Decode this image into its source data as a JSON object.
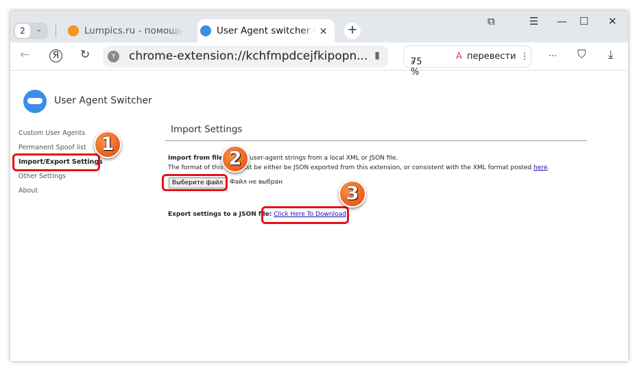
{
  "browser": {
    "tab_count": "2",
    "tabs": [
      {
        "title": "Lumpics.ru - помощь с компьютером",
        "icon": "orange-icon"
      },
      {
        "title": "User Agent switcher controls",
        "icon": "mask-icon",
        "close": "×"
      }
    ],
    "new_tab": "+",
    "url": "chrome-extension://kchfmpdcejfkipopn...",
    "zoom": "75 %",
    "translate": "перевести",
    "more": "..."
  },
  "app": {
    "title": "User Agent Switcher"
  },
  "sidebar": {
    "items": [
      {
        "label": "Custom User Agents"
      },
      {
        "label": "Permanent Spoof list"
      },
      {
        "label": "Import/Export Settings",
        "active": true
      },
      {
        "label": "Other Settings"
      },
      {
        "label": "About"
      }
    ]
  },
  "main": {
    "heading": "Import Settings",
    "import_label": "Import from file:",
    "import_text": " Import user-agent strings from a local XML or JSON file.",
    "format_text": "The format of this file must be either be JSON exported from this extension, or consistent with the XML format posted ",
    "here_link": "here",
    "choose_button": "Выберите файл",
    "no_file": "Файл не выбран",
    "export_label": "Export settings to a JSON file:",
    "download_link": "Click Here To Download"
  },
  "annotations": [
    "1",
    "2",
    "3"
  ],
  "colors": {
    "highlight": "#e8101a",
    "badge": "#f0641e",
    "accent": "#3b8ee8"
  }
}
